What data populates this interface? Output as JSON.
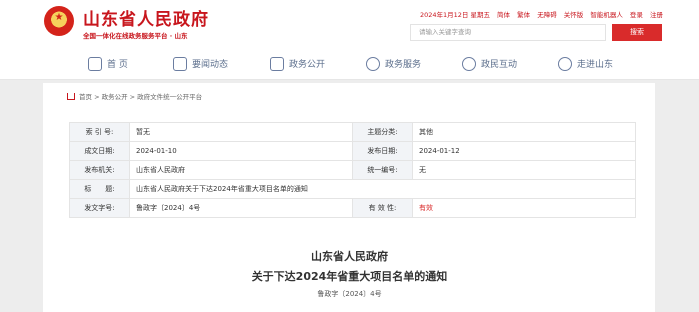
{
  "header": {
    "site_title": "山东省人民政府",
    "site_subtitle": "全国一体化在线政务服务平台 · 山东",
    "date": "2024年1月12日 星期五",
    "links": [
      "简体",
      "繁体",
      "无障碍",
      "关怀版",
      "智能机器人",
      "登录",
      "注册"
    ],
    "search_placeholder": "请输入关键字查询",
    "search_button": "搜索"
  },
  "nav": [
    "首 页",
    "要闻动态",
    "政务公开",
    "政务服务",
    "政民互动",
    "走进山东"
  ],
  "breadcrumb": "首页 > 政务公开 > 政府文件统一公开平台",
  "info": {
    "index_label": "索 引 号:",
    "index_value": "暂无",
    "category_label": "主题分类:",
    "category_value": "其他",
    "written_label": "成文日期:",
    "written_value": "2024-01-10",
    "published_label": "发布日期:",
    "published_value": "2024-01-12",
    "issuer_label": "发布机关:",
    "issuer_value": "山东省人民政府",
    "unified_label": "统一编号:",
    "unified_value": "无",
    "title_label": "标　　题:",
    "title_value": "山东省人民政府关于下达2024年省重大项目名单的通知",
    "docno_label": "发文字号:",
    "docno_value": "鲁政字〔2024〕4号",
    "validity_label": "有 效 性:",
    "validity_value": "有效"
  },
  "document": {
    "title_line1": "山东省人民政府",
    "title_line2": "关于下达2024年省重大项目名单的通知",
    "number": "鲁政字〔2024〕4号"
  },
  "colors": {
    "brand_red": "#c8161d",
    "button_red": "#d92b2b",
    "nav_text": "#5b6e8c"
  }
}
